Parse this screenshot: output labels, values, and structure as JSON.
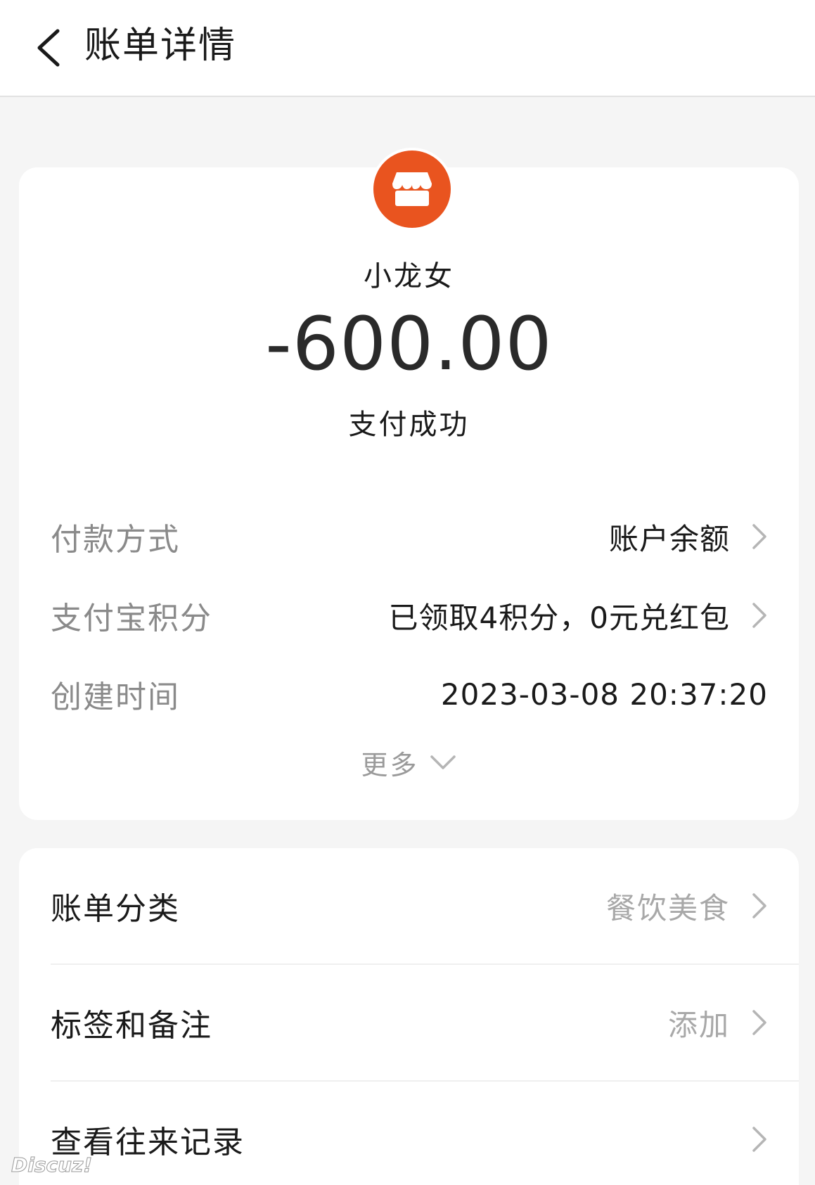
{
  "header": {
    "title": "账单详情"
  },
  "transaction": {
    "merchant_name": "小龙女",
    "amount": "-600.00",
    "status": "支付成功"
  },
  "details": {
    "payment_method": {
      "label": "付款方式",
      "value": "账户余额"
    },
    "points": {
      "label": "支付宝积分",
      "value": "已领取4积分，0元兑红包"
    },
    "created_time": {
      "label": "创建时间",
      "value": "2023-03-08 20:37:20"
    },
    "more_label": "更多"
  },
  "actions": {
    "category": {
      "label": "账单分类",
      "value": "餐饮美食"
    },
    "tags": {
      "label": "标签和备注",
      "value": "添加"
    },
    "history": {
      "label": "查看往来记录"
    }
  },
  "watermark": "Discuz!",
  "colors": {
    "accent": "#e9541f",
    "background": "#f5f5f5"
  }
}
